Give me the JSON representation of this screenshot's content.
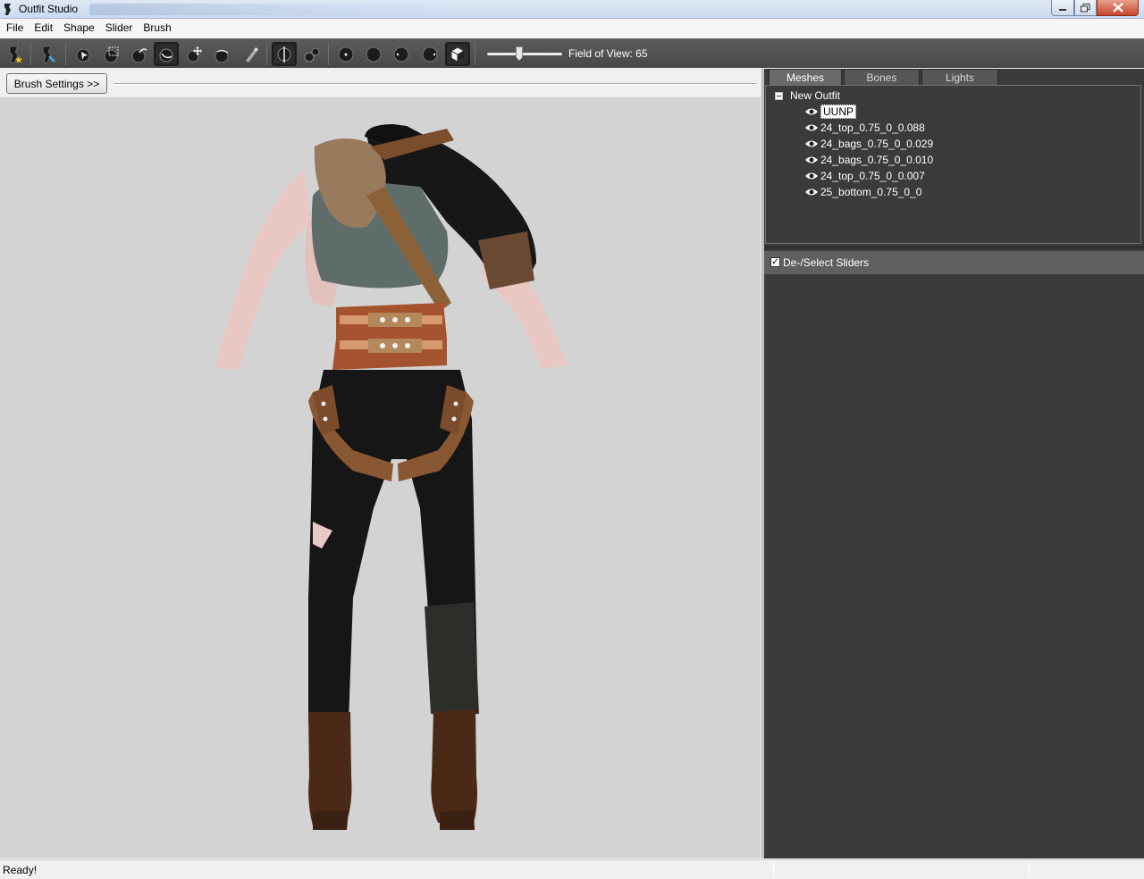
{
  "window": {
    "title": "Outfit Studio"
  },
  "menubar": {
    "items": [
      "File",
      "Edit",
      "Shape",
      "Slider",
      "Brush"
    ]
  },
  "toolbar": {
    "fov_label": "Field of View: 65",
    "fov_value": 65,
    "tools": [
      "load-reference-icon",
      "new-project-icon",
      "select-brush-icon",
      "mask-brush-icon",
      "inflate-brush-icon",
      "deflate-brush-icon",
      "move-brush-icon",
      "smooth-brush-icon",
      "weight-brush-icon",
      "x-mirror-icon",
      "connected-only-icon",
      "brush-size-small-icon",
      "brush-size-medium-icon",
      "brush-size-large-icon",
      "brush-size-xlarge-icon",
      "view-mode-icon"
    ]
  },
  "viewport": {
    "brush_settings_label": "Brush Settings >>",
    "background_color": "#d3d3d3"
  },
  "right_panel": {
    "tabs": [
      "Meshes",
      "Bones",
      "Lights"
    ],
    "active_tab": "Meshes",
    "tree": {
      "root": "New Outfit",
      "meshes": [
        {
          "name": "UUNP",
          "selected": true
        },
        {
          "name": "24_top_0.75_0_0.088",
          "selected": false
        },
        {
          "name": "24_bags_0.75_0_0.029",
          "selected": false
        },
        {
          "name": "24_bags_0.75_0_0.010",
          "selected": false
        },
        {
          "name": "24_top_0.75_0_0.007",
          "selected": false
        },
        {
          "name": "25_bottom_0.75_0_0",
          "selected": false
        }
      ]
    },
    "sliders_header": {
      "label": "De-/Select Sliders",
      "checked": true
    }
  },
  "statusbar": {
    "text": "Ready!"
  },
  "colors": {
    "panel_dark": "#3b3b3b",
    "toolbar": "#505050",
    "viewport": "#d3d3d3"
  }
}
